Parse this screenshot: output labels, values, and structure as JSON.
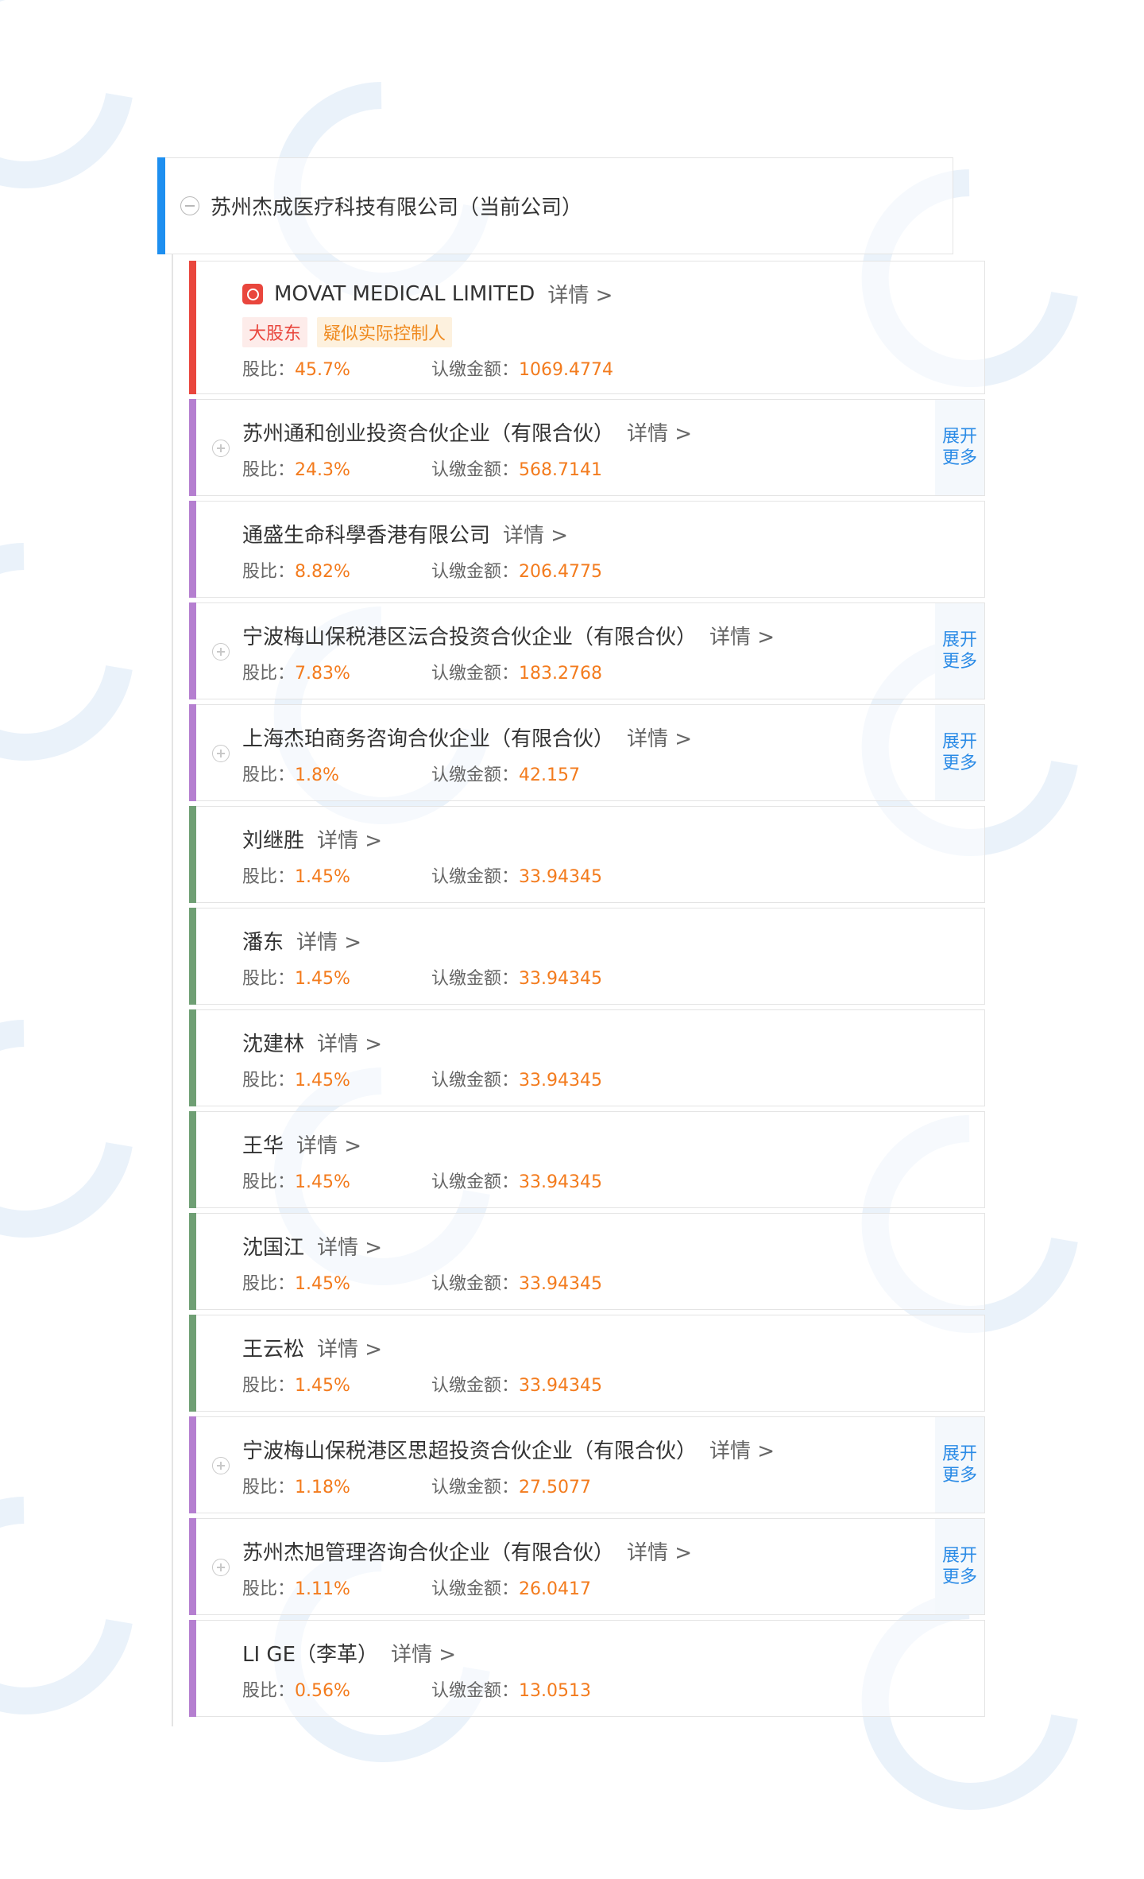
{
  "root": {
    "name": "苏州杰成医疗科技有限公司（当前公司）"
  },
  "labels": {
    "detail": "详情 >",
    "ratio": "股比：",
    "amount": "认缴金额：",
    "expand_line1": "展开",
    "expand_line2": "更多"
  },
  "colors": {
    "red": "#e9463d",
    "purple": "#b57fd0",
    "green": "#6f9f74",
    "accent": "#1e8ff0",
    "value": "#f37b1d",
    "link": "#2b8be6"
  },
  "shareholders": [
    {
      "name": "MOVAT MEDICAL LIMITED",
      "ratio": "45.7%",
      "amount": "1069.4774",
      "color": "red",
      "tags": [
        {
          "text": "大股东",
          "style": "red"
        },
        {
          "text": "疑似实际控制人",
          "style": "orange"
        }
      ],
      "expandable": false,
      "logo": "movat-logo-icon"
    },
    {
      "name": "苏州通和创业投资合伙企业（有限合伙）",
      "ratio": "24.3%",
      "amount": "568.7141",
      "color": "purple",
      "tags": [],
      "expandable": true
    },
    {
      "name": "通盛生命科學香港有限公司",
      "ratio": "8.82%",
      "amount": "206.4775",
      "color": "purple",
      "tags": [],
      "expandable": false
    },
    {
      "name": "宁波梅山保税港区沄合投资合伙企业（有限合伙）",
      "ratio": "7.83%",
      "amount": "183.2768",
      "color": "purple",
      "tags": [],
      "expandable": true
    },
    {
      "name": "上海杰珀商务咨询合伙企业（有限合伙）",
      "ratio": "1.8%",
      "amount": "42.157",
      "color": "purple",
      "tags": [],
      "expandable": true
    },
    {
      "name": "刘继胜",
      "ratio": "1.45%",
      "amount": "33.94345",
      "color": "green",
      "tags": [],
      "expandable": false
    },
    {
      "name": "潘东",
      "ratio": "1.45%",
      "amount": "33.94345",
      "color": "green",
      "tags": [],
      "expandable": false
    },
    {
      "name": "沈建林",
      "ratio": "1.45%",
      "amount": "33.94345",
      "color": "green",
      "tags": [],
      "expandable": false
    },
    {
      "name": "王华",
      "ratio": "1.45%",
      "amount": "33.94345",
      "color": "green",
      "tags": [],
      "expandable": false
    },
    {
      "name": "沈国江",
      "ratio": "1.45%",
      "amount": "33.94345",
      "color": "green",
      "tags": [],
      "expandable": false
    },
    {
      "name": "王云松",
      "ratio": "1.45%",
      "amount": "33.94345",
      "color": "green",
      "tags": [],
      "expandable": false
    },
    {
      "name": "宁波梅山保税港区思超投资合伙企业（有限合伙）",
      "ratio": "1.18%",
      "amount": "27.5077",
      "color": "purple",
      "tags": [],
      "expandable": true
    },
    {
      "name": "苏州杰旭管理咨询合伙企业（有限合伙）",
      "ratio": "1.11%",
      "amount": "26.0417",
      "color": "purple",
      "tags": [],
      "expandable": true
    },
    {
      "name": "LI GE（李革）",
      "ratio": "0.56%",
      "amount": "13.0513",
      "color": "purple",
      "tags": [],
      "expandable": false
    }
  ]
}
